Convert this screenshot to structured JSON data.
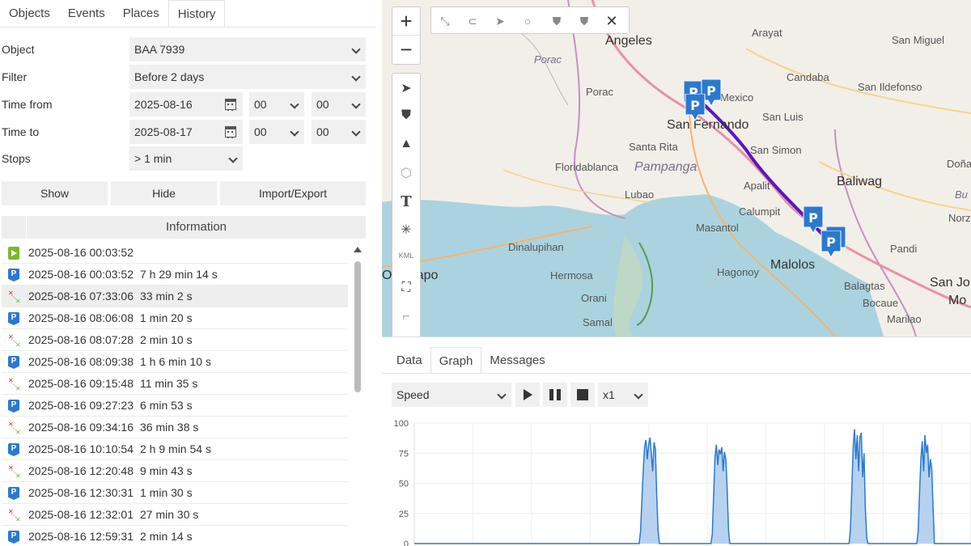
{
  "tabs": [
    "Objects",
    "Events",
    "Places",
    "History"
  ],
  "active_tab": "History",
  "form": {
    "object": {
      "label": "Object",
      "value": "BAA 7939"
    },
    "filter": {
      "label": "Filter",
      "value": "Before 2 days"
    },
    "time_from": {
      "label": "Time from",
      "date": "2025-08-16",
      "hour": "00",
      "minute": "00"
    },
    "time_to": {
      "label": "Time to",
      "date": "2025-08-17",
      "hour": "00",
      "minute": "00"
    },
    "stops": {
      "label": "Stops",
      "value": "> 1 min"
    }
  },
  "buttons": {
    "show": "Show",
    "hide": "Hide",
    "import_export": "Import/Export"
  },
  "info_header": "Information",
  "history": [
    {
      "type": "start",
      "date": "2025-08-16 00:03:52",
      "duration": ""
    },
    {
      "type": "park",
      "date": "2025-08-16 00:03:52",
      "duration": "7 h 29 min 14 s"
    },
    {
      "type": "route",
      "date": "2025-08-16 07:33:06",
      "duration": "33 min 2 s"
    },
    {
      "type": "park",
      "date": "2025-08-16 08:06:08",
      "duration": "1 min 20 s"
    },
    {
      "type": "route",
      "date": "2025-08-16 08:07:28",
      "duration": "2 min 10 s"
    },
    {
      "type": "park",
      "date": "2025-08-16 08:09:38",
      "duration": "1 h 6 min 10 s"
    },
    {
      "type": "route",
      "date": "2025-08-16 09:15:48",
      "duration": "11 min 35 s"
    },
    {
      "type": "park",
      "date": "2025-08-16 09:27:23",
      "duration": "6 min 53 s"
    },
    {
      "type": "route",
      "date": "2025-08-16 09:34:16",
      "duration": "36 min 38 s"
    },
    {
      "type": "park",
      "date": "2025-08-16 10:10:54",
      "duration": "2 h 9 min 54 s"
    },
    {
      "type": "route",
      "date": "2025-08-16 12:20:48",
      "duration": "9 min 43 s"
    },
    {
      "type": "park",
      "date": "2025-08-16 12:30:31",
      "duration": "1 min 30 s"
    },
    {
      "type": "route",
      "date": "2025-08-16 12:32:01",
      "duration": "27 min 30 s"
    },
    {
      "type": "park",
      "date": "2025-08-16 12:59:31",
      "duration": "2 min 14 s"
    }
  ],
  "selected_history_row": 2,
  "map": {
    "zoom_in": "+",
    "zoom_out": "−",
    "kml_label": "KML",
    "places": [
      "Angeles",
      "Arayat",
      "San Miguel",
      "Porac",
      "Candaba",
      "San Ildefonso",
      "Mexico",
      "San Fernando",
      "San Luis",
      "Santa Rita",
      "San Simon",
      "Floridablanca",
      "Pampanga",
      "Doña",
      "Baliwag",
      "Lubao",
      "Apalit",
      "Bu",
      "Calumpit",
      "Norzag",
      "Masantol",
      "Dinalupihan",
      "Pandi",
      "Olongapo",
      "Malolos",
      "Hermosa",
      "Hagonoy",
      "San Jo",
      "Balagtas",
      "Mo",
      "Orani",
      "Bocaue",
      "Marilao",
      "Samal"
    ],
    "route_color": "#5b16c4"
  },
  "bottom_tabs": [
    "Data",
    "Graph",
    "Messages"
  ],
  "active_bottom_tab": "Graph",
  "graph_controls": {
    "metric": "Speed",
    "speed": "x1"
  },
  "chart_data": {
    "type": "area",
    "yticks": [
      0,
      25,
      50,
      75,
      100
    ],
    "ylim": [
      0,
      100
    ],
    "grid": true,
    "series": [
      {
        "values": [
          0,
          0,
          0,
          0,
          0,
          0,
          0,
          0,
          0,
          0,
          0,
          0,
          0,
          0,
          0,
          0,
          0,
          0,
          0,
          0,
          0,
          0,
          0,
          0,
          0,
          0,
          0,
          0,
          0,
          0,
          0,
          0,
          0,
          0,
          0,
          0,
          0,
          0,
          0,
          0,
          0,
          0,
          0,
          0,
          0,
          0,
          0,
          0,
          0,
          0,
          0,
          0,
          0,
          0,
          0,
          0,
          0,
          0,
          0,
          0,
          0,
          0,
          0,
          0,
          0,
          0,
          0,
          0,
          0,
          0,
          0,
          0,
          0,
          0,
          0,
          0,
          0,
          0,
          0,
          0,
          0,
          0,
          0,
          0,
          0,
          0,
          0,
          0,
          0,
          0,
          0,
          0,
          0,
          0,
          0,
          0,
          0,
          0,
          0,
          0,
          0,
          0,
          0,
          0,
          0,
          0,
          0,
          0,
          0,
          0,
          0,
          0,
          0,
          0,
          0,
          0,
          0,
          0,
          0,
          0,
          0,
          0,
          0,
          0,
          0,
          0,
          0,
          0,
          0,
          0,
          0,
          0,
          0,
          0,
          0,
          0,
          0,
          0,
          0,
          0,
          0,
          0,
          0,
          0,
          0,
          0,
          0,
          0,
          0,
          0,
          0,
          0,
          0,
          0,
          0,
          0,
          0,
          0,
          0,
          0,
          0,
          0,
          0,
          0,
          0,
          0,
          0,
          10,
          35,
          60,
          80,
          86,
          70,
          82,
          88,
          75,
          60,
          84,
          78,
          40,
          10,
          0,
          0,
          0,
          0,
          0,
          0,
          0,
          0,
          0,
          0,
          0,
          0,
          0,
          0,
          0,
          0,
          0,
          0,
          0,
          0,
          0,
          0,
          0,
          0,
          0,
          0,
          0,
          0,
          0,
          0,
          0,
          0,
          0,
          0,
          0,
          0,
          0,
          0,
          0,
          8,
          40,
          72,
          82,
          65,
          78,
          74,
          80,
          60,
          76,
          70,
          45,
          10,
          0,
          0,
          0,
          0,
          0,
          0,
          0,
          0,
          0,
          0,
          0,
          0,
          0,
          0,
          0,
          0,
          0,
          0,
          0,
          0,
          0,
          0,
          0,
          0,
          0,
          0,
          0,
          0,
          0,
          0,
          0,
          0,
          0,
          0,
          0,
          0,
          0,
          0,
          0,
          0,
          0,
          0,
          0,
          0,
          0,
          0,
          0,
          0,
          0,
          0,
          0,
          0,
          0,
          0,
          0,
          0,
          0,
          0,
          0,
          0,
          0,
          0,
          0,
          0,
          0,
          0,
          0,
          0,
          0,
          0,
          0,
          0,
          0,
          0,
          0,
          0,
          0,
          0,
          0,
          0,
          0,
          0,
          0,
          0,
          0,
          0,
          0,
          0,
          0,
          12,
          45,
          80,
          95,
          70,
          90,
          60,
          88,
          92,
          55,
          75,
          30,
          5,
          0,
          0,
          0,
          0,
          0,
          0,
          0,
          0,
          0,
          0,
          0,
          0,
          0,
          0,
          0,
          0,
          0,
          0,
          0,
          0,
          0,
          0,
          0,
          0,
          0,
          0,
          0,
          0,
          0,
          0,
          0,
          0,
          0,
          0,
          0,
          0,
          0,
          10,
          42,
          70,
          85,
          60,
          90,
          75,
          82,
          55,
          70,
          62,
          30,
          0,
          0,
          0,
          0,
          0,
          0,
          0,
          0,
          0,
          0,
          0,
          0,
          0,
          0,
          0,
          0,
          0,
          0,
          0,
          0,
          0,
          0,
          0,
          0,
          0,
          0,
          0,
          0
        ]
      }
    ]
  }
}
